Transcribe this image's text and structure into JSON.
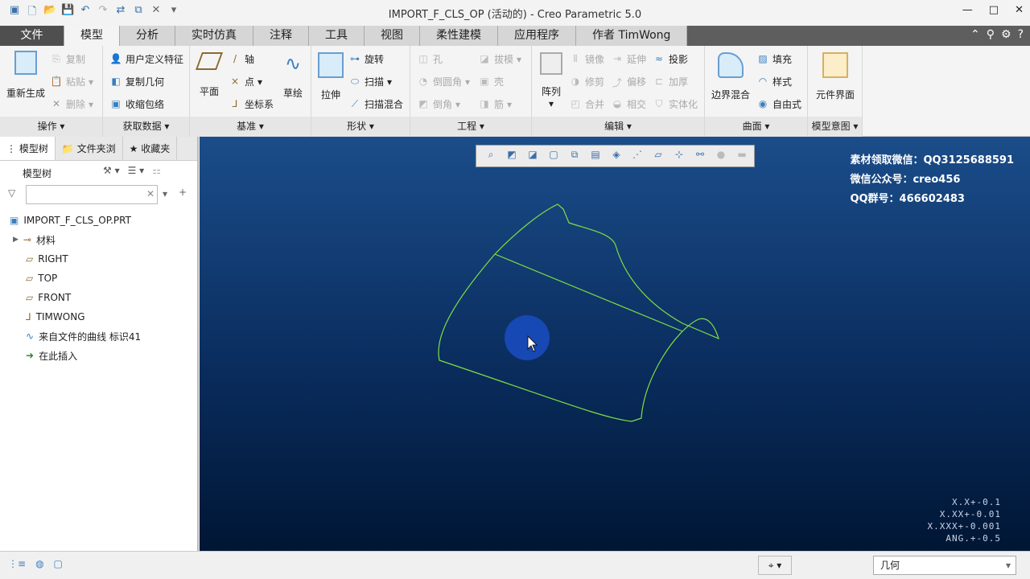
{
  "title": "IMPORT_F_CLS_OP (活动的) - Creo Parametric 5.0",
  "tabs": [
    "文件",
    "模型",
    "分析",
    "实时仿真",
    "注释",
    "工具",
    "视图",
    "柔性建模",
    "应用程序",
    "作者 TimWong"
  ],
  "active_tab": "模型",
  "ribbon": {
    "ops": {
      "regen": "重新生成",
      "copy": "复制",
      "paste": "粘贴",
      "delete": "删除",
      "label": "操作"
    },
    "getdata": {
      "udf": "用户定义特征",
      "copygeom": "复制几何",
      "shrink": "收缩包络",
      "label": "获取数据"
    },
    "datum": {
      "plane": "平面",
      "axis": "轴",
      "point": "点",
      "csys": "坐标系",
      "sketch": "草绘",
      "label": "基准"
    },
    "shape": {
      "extrude": "拉伸",
      "revolve": "旋转",
      "sweep": "扫描",
      "swblend": "扫描混合",
      "label": "形状"
    },
    "eng": {
      "hole": "孔",
      "draft": "拔模",
      "round": "倒圆角",
      "shell": "壳",
      "chamfer": "倒角",
      "rib": "筋",
      "label": "工程"
    },
    "edit": {
      "pattern": "阵列",
      "mirror": "镜像",
      "extend": "延伸",
      "project": "投影",
      "trim": "修剪",
      "offset": "偏移",
      "thicken": "加厚",
      "merge": "合并",
      "intersect": "相交",
      "solidify": "实体化",
      "label": "编辑"
    },
    "surface": {
      "boundary": "边界混合",
      "fill": "填充",
      "style": "样式",
      "freestyle": "自由式",
      "label": "曲面"
    },
    "intent": {
      "component": "元件界面",
      "label": "模型意图"
    }
  },
  "left": {
    "tabs": [
      "模型树",
      "文件夹浏",
      "收藏夹"
    ],
    "header": "模型树",
    "search_placeholder": "",
    "tree": [
      "IMPORT_F_CLS_OP.PRT",
      "材料",
      "RIGHT",
      "TOP",
      "FRONT",
      "TIMWONG",
      "来自文件的曲线 标识41",
      "在此插入"
    ]
  },
  "watermark": [
    "素材领取微信：QQ3125688591",
    "微信公众号：creo456",
    "QQ群号：466602483"
  ],
  "tolerances": [
    "X.X+-0.1",
    "X.XX+-0.01",
    "X.XXX+-0.001",
    "ANG.+-0.5"
  ],
  "status": {
    "filter": "几何"
  },
  "colors": {
    "curve": "#7fe040",
    "viewport_top": "#1b4d8a",
    "viewport_bottom": "#001634"
  }
}
